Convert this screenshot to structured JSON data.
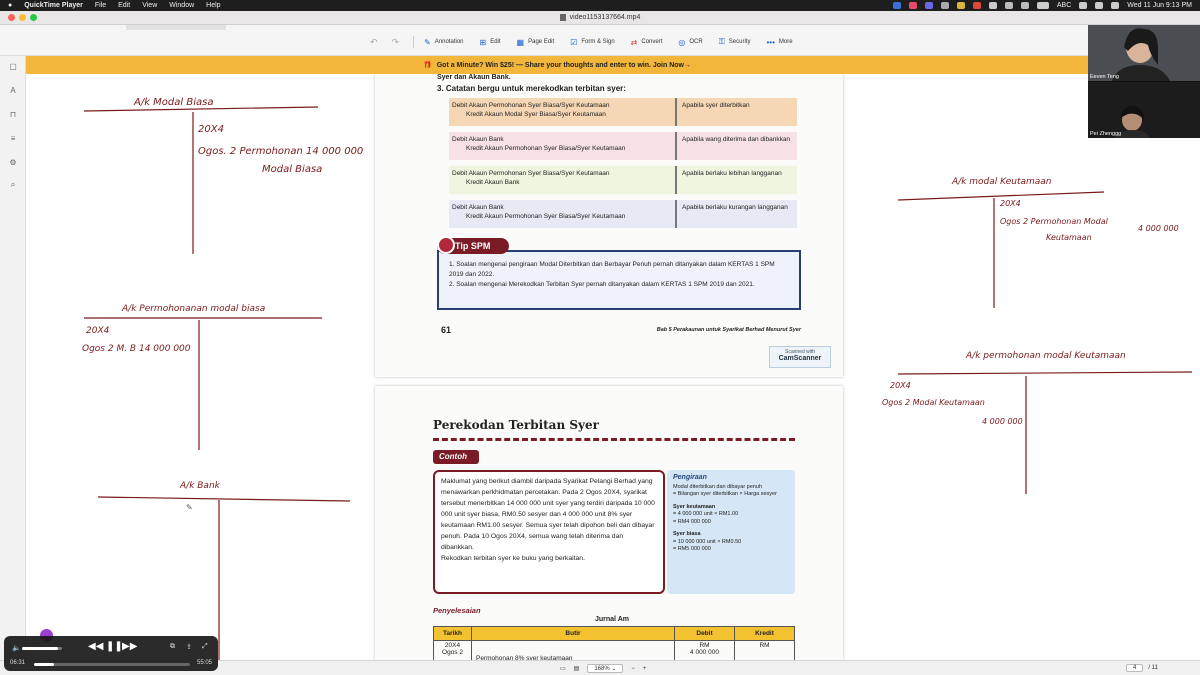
{
  "menubar": {
    "app": "QuickTime Player",
    "items": [
      "File",
      "Edit",
      "View",
      "Window",
      "Help"
    ],
    "input_label": "ABC",
    "clock": "Wed 11 Jun  9:13 PM"
  },
  "window": {
    "title": "video1153137664.mp4"
  },
  "toolbar": {
    "tools": [
      {
        "label": "Annotation",
        "icon": "pen-icon"
      },
      {
        "label": "Edit",
        "icon": "edit-icon"
      },
      {
        "label": "Page Edit",
        "icon": "grid-icon"
      },
      {
        "label": "Form & Sign",
        "icon": "checkbox-icon"
      },
      {
        "label": "Convert",
        "icon": "convert-icon"
      },
      {
        "label": "OCR",
        "icon": "ocr-icon"
      },
      {
        "label": "Security",
        "icon": "lock-icon"
      },
      {
        "label": "More",
        "icon": "ellipsis-icon"
      }
    ]
  },
  "banner": {
    "text": "Got a Minute? Win $25! — Share your thoughts and enter to win.  Join Now→"
  },
  "handwriting": {
    "ak1_title": "A/k  Modal  Biasa",
    "ak1_year": "20X4",
    "ak1_line1": "Ogos. 2  Permohonan  14 000 000",
    "ak1_line2": "Modal  Biasa",
    "ak2_title": "A/k  Permohonanan  modal  biasa",
    "ak2_year": "20X4",
    "ak2_line1": "Ogos 2  M. B  14 000 000",
    "ak3_title": "A/k  Bank",
    "ak4_title": "A/k  modal  Keutamaan",
    "ak4_year": "20X4",
    "ak4_line1": "Ogos 2   Permohonan  Modal",
    "ak4_line2": "Keutamaan",
    "ak4_amount": "4 000 000",
    "ak5_title": "A/k  permohonan  modal  Keutamaan",
    "ak5_year": "20X4",
    "ak5_line1": "Ogos 2  Modal  Keutamaan",
    "ak5_amount": "4 000 000"
  },
  "page1": {
    "top": "Syer dan Akaun Bank.",
    "q3": "3.  Catatan bergu untuk merekodkan terbitan syer:",
    "rows": [
      {
        "l1": "Debit Akaun Permohonan Syer Biasa/Syer Keutamaan",
        "l2": "Kredit Akaun Modal Syer Biasa/Syer Keutamaan",
        "r": "Apabila syer diterbitkan"
      },
      {
        "l1": "Debit Akaun Bank",
        "l2": "Kredit Akaun Permohonan Syer Biasa/Syer Keutamaan",
        "r": "Apabila wang diterima dan dibankkan"
      },
      {
        "l1": "Debit Akaun Permohonan Syer Biasa/Syer Keutamaan",
        "l2": "Kredit Akaun Bank",
        "r": "Apabila berlaku lebihan langganan"
      },
      {
        "l1": "Debit Akaun Bank",
        "l2": "Kredit Akaun Permohonan Syer Biasa/Syer Keutamaan",
        "r": "Apabila berlaku kurangan langganan"
      }
    ],
    "tip_title": "Tip SPM",
    "tip1": "1.  Soalan mengenai pengiraan Modal Diterbitkan dan Berbayar Penuh pernah ditanyakan dalam KERTAS 1 SPM 2019 dan 2022.",
    "tip2": "2.  Soalan mengenai Merekodkan Terbitan Syer pernah ditanyakan dalam KERTAS 1 SPM 2019 dan 2021.",
    "page_num": "61",
    "footer": "Bab 5  Perakaunan untuk Syarikat Berhad Menurut Syer",
    "scanned": "Scanned with",
    "camscanner": "CamScanner"
  },
  "page2": {
    "title": "Perekodan Terbitan Syer",
    "contoh": "Contoh",
    "example": "Maklumat yang berikut diambil daripada Syarikat Pelangi Berhad yang menawarkan perkhidmatan percetakan. Pada 2 Ogos 20X4, syarikat tersebut menerbitkan 14 000 000 unit syer yang terdiri daripada 10 000 000 unit syer biasa, RM0.50 sesyer dan 4 000 000 unit 8% syer keutamaan RM1.00 sesyer. Semua syer telah dipohon beli dan dibayar penuh. Pada 10 Ogos 20X4, semua wang telah diterima dan dibankkan.",
    "example_task": "Rekodkan terbitan syer ke buku yang berkaitan.",
    "pg_head": "Pengiraan",
    "pg_formula1": "Modal diterbitkan dan dibayar penuh",
    "pg_formula2": "= Bilangan syer diterbitkan × Harga sesyer",
    "pg_sk": "Syer keutamaan",
    "pg_sk1": "= 4 000 000 unit × RM1.00",
    "pg_sk2": "= RM4 000 000",
    "pg_sb": "Syer biasa",
    "pg_sb1": "= 10 000 000 unit × RM0.50",
    "pg_sb2": "= RM5 000 000",
    "penyelesaian": "Penyelesaian",
    "jurnal": "Jurnal Am",
    "headers": [
      "Tarikh",
      "Butir",
      "Debit",
      "Kredit"
    ],
    "row_date1": "20X4",
    "row_date2": "Ogos 2",
    "row_butir": "Permohonan 8% syer keutamaan",
    "row_debit1": "RM",
    "row_debit2": "4 000 000",
    "row_kredit": "RM"
  },
  "cams": {
    "cam1": "Eeven Teng",
    "cam2": "Pei Zhenggg"
  },
  "status": {
    "zoom": "168%",
    "page_current": "4",
    "page_total": "/ 11"
  },
  "player": {
    "elapsed": "06:31",
    "total": "55:05"
  }
}
